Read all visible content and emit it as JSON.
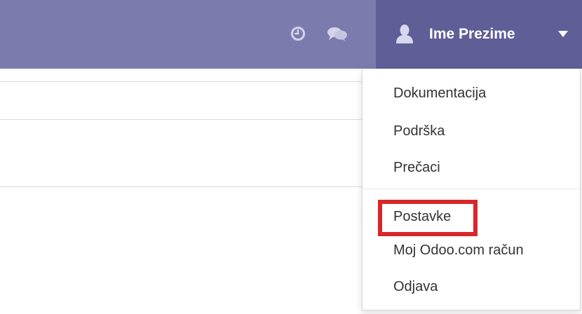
{
  "topbar": {
    "icons": [
      "clock-icon",
      "chat-icon"
    ],
    "user_menu": {
      "avatar_icon": "user-silhouette-icon",
      "name": "Ime Prezime",
      "caret_icon": "caret-down-icon"
    }
  },
  "dropdown": {
    "items": [
      {
        "label": "Dokumentacija"
      },
      {
        "label": "Podrška"
      },
      {
        "label": "Prečaci"
      },
      {
        "label": "Postavke",
        "highlighted": true
      },
      {
        "label": "Moj Odoo.com račun"
      },
      {
        "label": "Odjava"
      }
    ]
  },
  "colors": {
    "topbar": "#7c7bad",
    "user_menu": "#5f5e97",
    "highlight": "#d9262a",
    "text": "#333333"
  }
}
